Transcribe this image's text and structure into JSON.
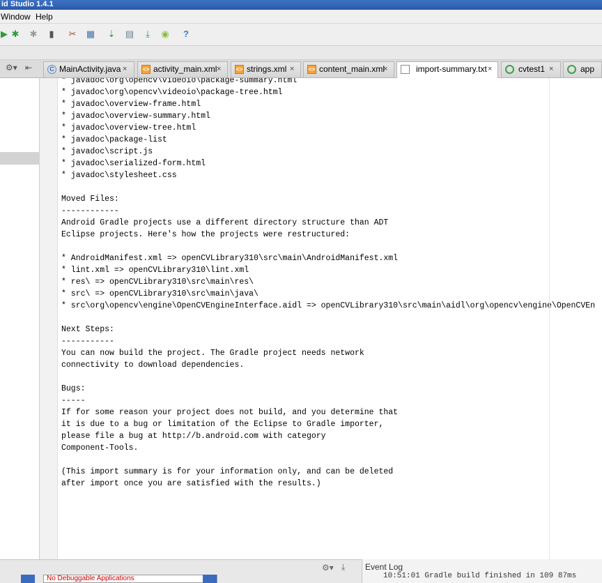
{
  "window": {
    "title": "id Studio 1.4.1"
  },
  "menu": {
    "items": [
      "Window",
      "Help"
    ]
  },
  "tabs": [
    {
      "label": "MainActivity.java",
      "kind": "java"
    },
    {
      "label": "activity_main.xml",
      "kind": "xml"
    },
    {
      "label": "strings.xml",
      "kind": "xml"
    },
    {
      "label": "content_main.xml",
      "kind": "xml"
    },
    {
      "label": "import-summary.txt",
      "kind": "txt",
      "active": true
    },
    {
      "label": "cvtest1",
      "kind": "module"
    },
    {
      "label": "app",
      "kind": "module"
    }
  ],
  "tab_close_glyph": "×",
  "editor": {
    "lines": [
      "* javadoc\\org\\opencv\\videoio\\package-summary.html",
      "* javadoc\\org\\opencv\\videoio\\package-tree.html",
      "* javadoc\\overview-frame.html",
      "* javadoc\\overview-summary.html",
      "* javadoc\\overview-tree.html",
      "* javadoc\\package-list",
      "* javadoc\\script.js",
      "* javadoc\\serialized-form.html",
      "* javadoc\\stylesheet.css",
      "",
      "Moved Files:",
      "------------",
      "Android Gradle projects use a different directory structure than ADT",
      "Eclipse projects. Here's how the projects were restructured:",
      "",
      "* AndroidManifest.xml => openCVLibrary310\\src\\main\\AndroidManifest.xml",
      "* lint.xml => openCVLibrary310\\lint.xml",
      "* res\\ => openCVLibrary310\\src\\main\\res\\",
      "* src\\ => openCVLibrary310\\src\\main\\java\\",
      "* src\\org\\opencv\\engine\\OpenCVEngineInterface.aidl => openCVLibrary310\\src\\main\\aidl\\org\\opencv\\engine\\OpenCVEn",
      "",
      "Next Steps:",
      "-----------",
      "You can now build the project. The Gradle project needs network",
      "connectivity to download dependencies.",
      "",
      "Bugs:",
      "-----",
      "If for some reason your project does not build, and you determine that",
      "it is due to a bug or limitation of the Eclipse to Gradle importer,",
      "please file a bug at http://b.android.com with category",
      "Component-Tools.",
      "",
      "(This import summary is for your information only, and can be deleted",
      "after import once you are satisfied with the results.)"
    ]
  },
  "event_log": {
    "title": "Event Log",
    "last_line": "10:51:01 Gradle build finished in 109 87ms"
  },
  "bottom": {
    "debug_field": "No Debuggable Applications"
  },
  "colors": {
    "title_bar": "#2a5aa8",
    "active_tab": "#ffffff",
    "selection": "#d3d3d3"
  }
}
